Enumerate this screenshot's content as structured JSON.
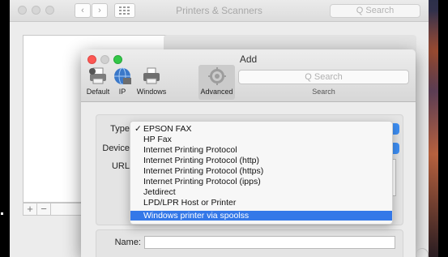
{
  "background_window": {
    "title": "Printers & Scanners",
    "search_placeholder": "Q Search",
    "plus": "+",
    "minus": "−"
  },
  "dialog": {
    "title": "Add",
    "toolbar": [
      {
        "label": "Default",
        "icon": "printer-icon"
      },
      {
        "label": "IP",
        "icon": "globe-icon"
      },
      {
        "label": "Windows",
        "icon": "windows-printer-icon"
      },
      {
        "label": "Advanced",
        "icon": "gear-icon"
      }
    ],
    "search_placeholder": "Q Search",
    "search_label": "Search",
    "fields": {
      "type_label": "Type",
      "device_label": "Device",
      "url_label": "URL",
      "name_label": "Name:"
    },
    "type_menu": {
      "items": [
        "EPSON FAX",
        "HP Fax",
        "Internet Printing Protocol",
        "Internet Printing Protocol (http)",
        "Internet Printing Protocol (https)",
        "Internet Printing Protocol (ipps)",
        "Jetdirect",
        "LPD/LPR Host or Printer",
        "Windows printer via spoolss"
      ],
      "checked": "EPSON FAX",
      "highlighted": "Windows printer via spoolss",
      "check_mark": "✓"
    }
  },
  "colors": {
    "highlight": "#3478e8",
    "accent_blue": "#3d8ef3",
    "close": "#fc5753",
    "minimize": "#fdbc40",
    "zoom": "#33c748"
  }
}
